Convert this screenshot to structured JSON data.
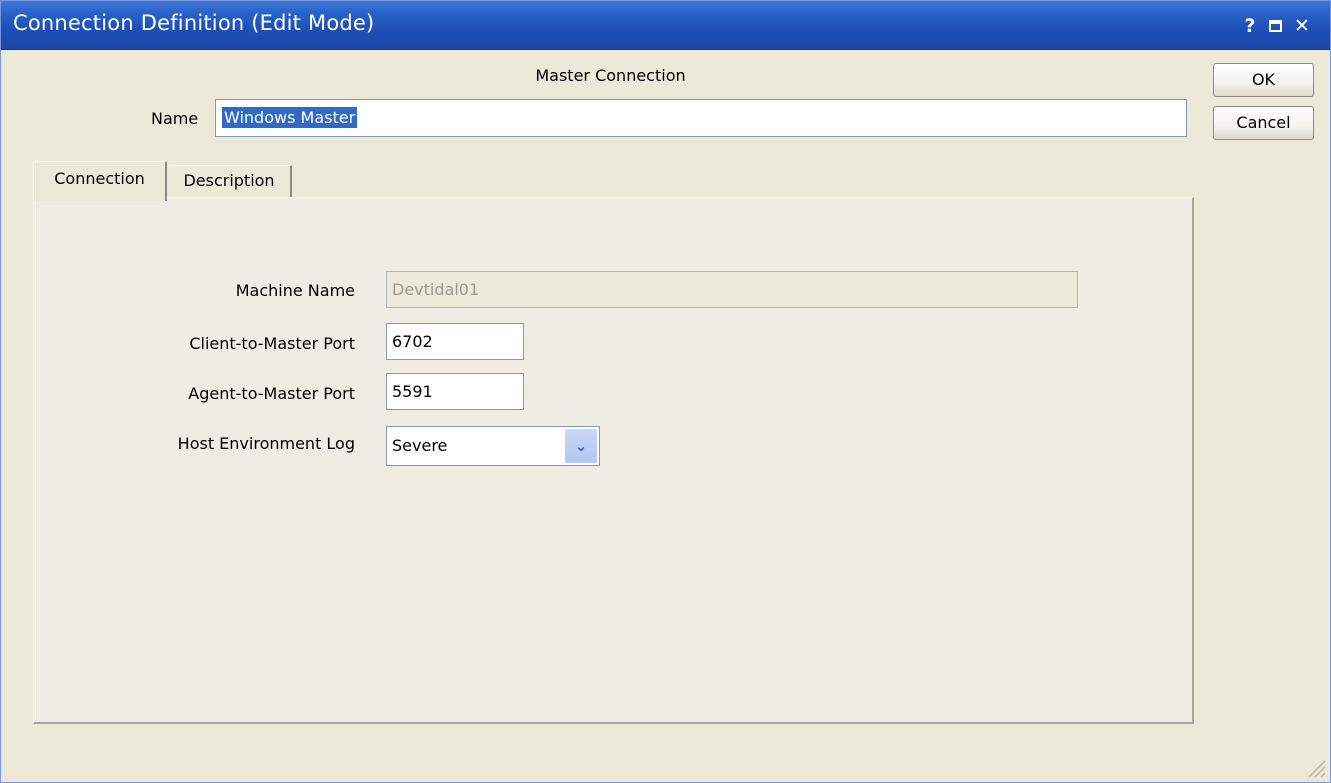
{
  "window": {
    "title": "Connection Definition (Edit Mode)",
    "controls": {
      "help": "?",
      "close": "✕"
    }
  },
  "header": {
    "text": "Master Connection"
  },
  "name": {
    "label": "Name",
    "value": "Windows Master"
  },
  "buttons": {
    "ok": "OK",
    "cancel": "Cancel"
  },
  "tabs": [
    {
      "label": "Connection",
      "active": true
    },
    {
      "label": "Description",
      "active": false
    }
  ],
  "form": {
    "machine_name": {
      "label": "Machine Name",
      "value": "Devtidal01",
      "disabled": true
    },
    "client_port": {
      "label": "Client-to-Master Port",
      "value": "6702"
    },
    "agent_port": {
      "label": "Agent-to-Master Port",
      "value": "5591"
    },
    "host_log": {
      "label": "Host Environment Log",
      "value": "Severe"
    }
  },
  "colors": {
    "titlebar": "#2a62c8",
    "selection": "#316ac5",
    "dialog_bg": "#ece9d8"
  }
}
